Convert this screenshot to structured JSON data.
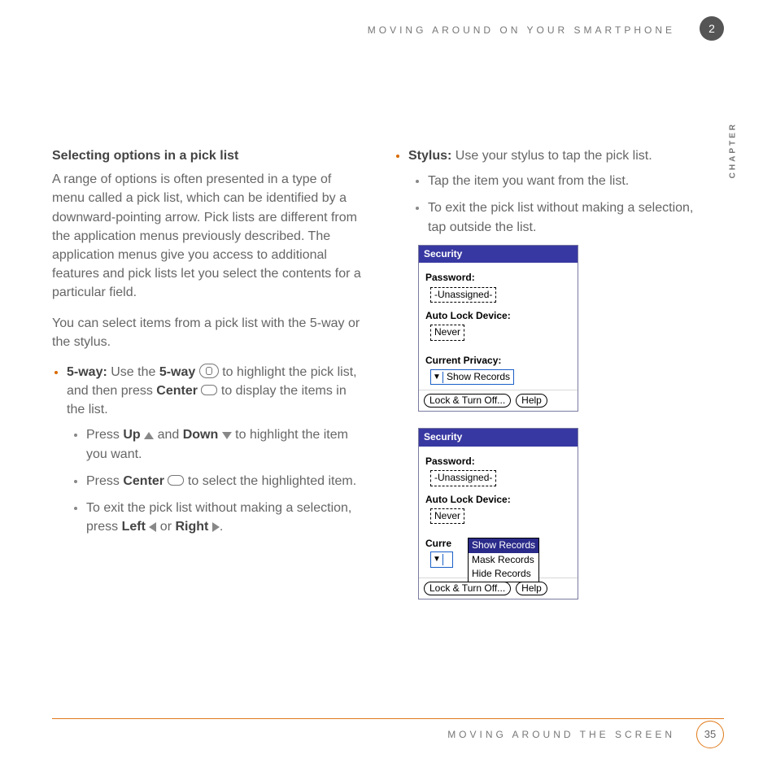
{
  "header": {
    "running": "MOVING AROUND ON YOUR SMARTPHONE",
    "chapter_number": "2",
    "side_label": "CHAPTER"
  },
  "left": {
    "heading": "Selecting options in a pick list",
    "para1": "A range of options is often presented in a type of menu called a pick list, which can be identified by a downward-pointing arrow. Pick lists are different from the application menus previously described. The application menus give you access to additional features and pick lists let you select the contents for a particular field.",
    "para2": "You can select items from a pick list with the 5-way or the stylus.",
    "fiveway_label": "5-way:",
    "fiveway_text_a": " Use the ",
    "fiveway_bold": "5-way",
    "fiveway_text_b": " to highlight the pick list, and then press ",
    "center_bold": "Center",
    "fiveway_text_c": " to display the items in the list.",
    "sub1_a": "Press ",
    "up_bold": "Up",
    "sub1_b": " and ",
    "down_bold": "Down",
    "sub1_c": " to highlight the item you want.",
    "sub2_a": "Press ",
    "sub2_b": " to select the highlighted item.",
    "sub3_a": "To exit the pick list without making a selection, press ",
    "left_bold": "Left",
    "sub3_b": " or ",
    "right_bold": "Right",
    "sub3_c": "."
  },
  "right": {
    "stylus_label": "Stylus:",
    "stylus_text": " Use your stylus to tap the pick list.",
    "sub1": "Tap the item you want from the list.",
    "sub2": "To exit the pick list without making a selection, tap outside the list."
  },
  "palm": {
    "title": "Security",
    "password_label": "Password:",
    "password_value": "-Unassigned-",
    "autolock_label": "Auto Lock Device:",
    "autolock_value": "Never",
    "privacy_label": "Current Privacy:",
    "privacy_label_short": "Curre",
    "privacy_value": "Show Records",
    "menu": [
      "Show Records",
      "Mask Records",
      "Hide Records"
    ],
    "btn_lock": "Lock & Turn Off...",
    "btn_help": "Help"
  },
  "footer": {
    "text": "MOVING AROUND THE SCREEN",
    "page": "35"
  }
}
